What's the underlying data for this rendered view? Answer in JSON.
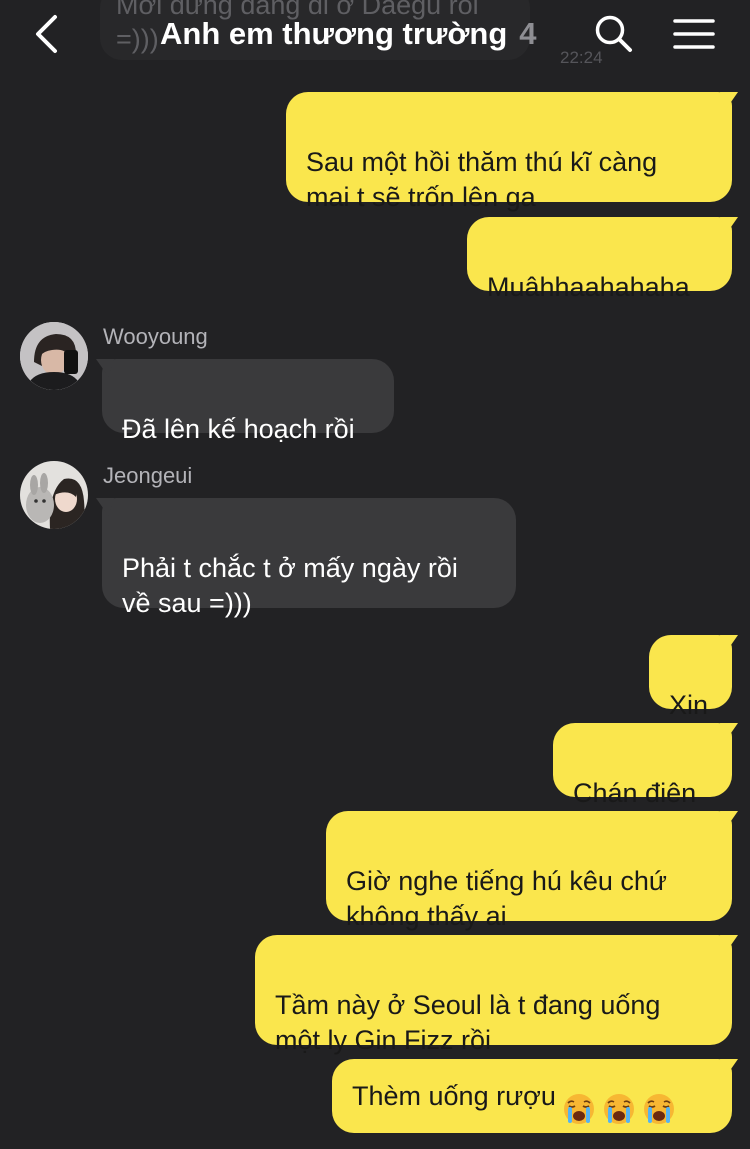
{
  "header": {
    "title": "Anh em thương trường",
    "member_count": "4"
  },
  "ghost": {
    "text": "Mới đứng đang đi ở Daegu rồi\n=)))",
    "time": "22:24"
  },
  "messages": [
    {
      "sender": "me",
      "text": "Sau một hồi thăm thú kĩ càng\nmai t sẽ trốn lên ga"
    },
    {
      "sender": "me",
      "text": "Muâhhaahahaha"
    },
    {
      "sender": "Wooyoung",
      "text": "Đã lên kế hoạch rồi"
    },
    {
      "sender": "Jeongeui",
      "text": "Phải t chắc t ở mấy ngày rồi\nvề sau =)))"
    },
    {
      "sender": "me",
      "text": "Xin"
    },
    {
      "sender": "me",
      "text": "Chán điên"
    },
    {
      "sender": "me",
      "text": "Giờ nghe tiếng hú kêu chứ\nkhông thấy ai"
    },
    {
      "sender": "me",
      "text": "Tầm này ở Seoul là t đang uống\nmột ly Gin Fizz rồi"
    },
    {
      "sender": "me",
      "text": "Thèm uống rượu",
      "emoji": [
        "loudly-crying-face",
        "loudly-crying-face",
        "loudly-crying-face"
      ]
    }
  ],
  "colors": {
    "background": "#222224",
    "my_bubble": "#fae64d",
    "other_bubble": "#3a3a3c",
    "sender_name": "#b3b3b8"
  },
  "icons": {
    "back": "chevron-left-icon",
    "search": "search-icon",
    "menu": "hamburger-menu-icon"
  }
}
